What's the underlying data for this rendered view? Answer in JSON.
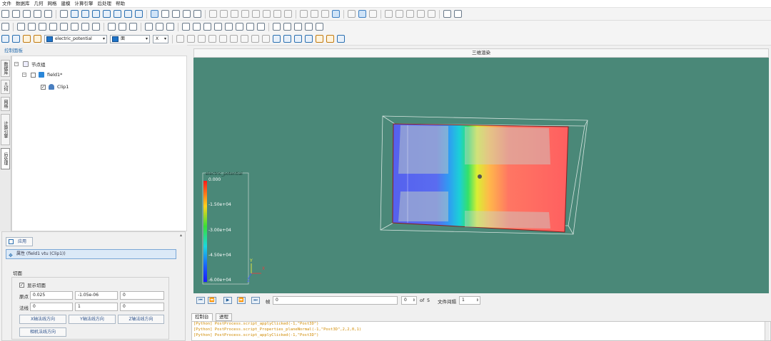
{
  "menu": [
    "文件",
    "数据库",
    "几何",
    "网格",
    "建模",
    "计算引擎",
    "后处理",
    "帮助"
  ],
  "toolbar3": {
    "field_select": "electric_potential",
    "display_select": "面",
    "axis_select": "X"
  },
  "left_panel": {
    "title": "控制面板",
    "vtabs": [
      "数据库",
      "几何",
      "网格",
      "计算引擎",
      "后处理"
    ],
    "tree": [
      {
        "label": "节点组"
      },
      {
        "label": "field1*"
      },
      {
        "label": "Clip1",
        "checked": true
      }
    ]
  },
  "props": {
    "apply_label": "应用",
    "title": "属性 (field1 vtu (Clip1))",
    "section": "切面",
    "show_plane_label": "显示切面",
    "show_plane_checked": true,
    "origin_label": "原点",
    "origin": [
      "0.025",
      "-1.05e-06",
      "0"
    ],
    "normal_label": "法线",
    "normal": [
      "0",
      "1",
      "0"
    ],
    "buttons": [
      "X轴法线方向",
      "Y轴法线方向",
      "Z轴法线方向"
    ],
    "camera_button": "相机法线方向"
  },
  "viewport": {
    "title": "三维渲染",
    "background": "#4a8878",
    "legend": {
      "title": "electric_potential",
      "ticks": [
        "0.000",
        "-1.50e+04",
        "-3.00e+04",
        "-4.50e+04",
        "-6.00e+04"
      ]
    },
    "axes": {
      "x": "X",
      "y": "Y",
      "z": "Z"
    }
  },
  "playbar": {
    "frame_label": "帧",
    "frame_value": "0",
    "current": "0",
    "of_label": "of",
    "total": "5",
    "interval_label": "文件间隔",
    "interval_value": "1"
  },
  "console": {
    "tabs": [
      "控制台",
      "进程"
    ],
    "lines": [
      "[Python]   PostProcess.script_applyClicked(-1,\"Post3D\")",
      "[Python]   PostProcess.script_Properties_planeNormal(-1,\"Post3D\",2,2,0,1)",
      "[Python]   PostProcess.script_applyClicked(-1,\"Post3D\")"
    ]
  }
}
